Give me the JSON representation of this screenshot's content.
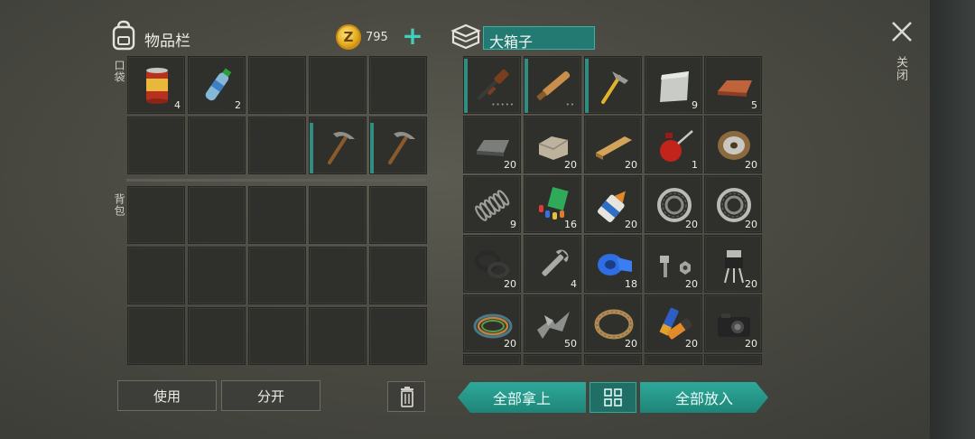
{
  "inventory": {
    "title": "物品栏",
    "coins": "795",
    "pocket_label": "口袋",
    "backpack_label": "背包",
    "pocket_slots": [
      {
        "icon": "canned-food-icon",
        "count": "4"
      },
      {
        "icon": "water-bottle-icon",
        "count": "2"
      },
      {
        "icon": "",
        "count": ""
      },
      {
        "icon": "",
        "count": ""
      },
      {
        "icon": "",
        "count": ""
      },
      {
        "icon": "",
        "count": ""
      },
      {
        "icon": "",
        "count": ""
      },
      {
        "icon": "",
        "count": ""
      },
      {
        "icon": "pickaxe-icon",
        "count": ""
      },
      {
        "icon": "pickaxe-icon",
        "count": ""
      }
    ],
    "backpack_slots": 15,
    "use_button": "使用",
    "split_button": "分开"
  },
  "chest": {
    "title": "大箱子",
    "take_all_button": "全部拿上",
    "put_all_button": "全部放入",
    "items": [
      {
        "icon": "shotgun-icon",
        "count": ""
      },
      {
        "icon": "wooden-club-icon",
        "count": ""
      },
      {
        "icon": "hammer-icon",
        "count": ""
      },
      {
        "icon": "metal-sheet-icon",
        "count": "9"
      },
      {
        "icon": "copper-ingot-icon",
        "count": "5"
      },
      {
        "icon": "iron-ingot-icon",
        "count": "20"
      },
      {
        "icon": "stone-block-icon",
        "count": "20"
      },
      {
        "icon": "wood-plank-icon",
        "count": "20"
      },
      {
        "icon": "oil-can-icon",
        "count": "1"
      },
      {
        "icon": "wire-spool-icon",
        "count": "20"
      },
      {
        "icon": "spring-icon",
        "count": "9"
      },
      {
        "icon": "pills-and-books-icon",
        "count": "16"
      },
      {
        "icon": "glue-tube-icon",
        "count": "20"
      },
      {
        "icon": "bearing-icon",
        "count": "20"
      },
      {
        "icon": "bearing-icon",
        "count": "20"
      },
      {
        "icon": "washers-icon",
        "count": "20"
      },
      {
        "icon": "wrench-icon",
        "count": "4"
      },
      {
        "icon": "tape-roll-icon",
        "count": "18"
      },
      {
        "icon": "bolt-and-nut-icon",
        "count": "20"
      },
      {
        "icon": "transistor-icon",
        "count": "20"
      },
      {
        "icon": "wire-coil-icon",
        "count": "20"
      },
      {
        "icon": "scrap-metal-icon",
        "count": "50"
      },
      {
        "icon": "rope-icon",
        "count": "20"
      },
      {
        "icon": "batteries-icon",
        "count": "20"
      },
      {
        "icon": "camera-icon",
        "count": "20"
      }
    ]
  },
  "close_label": "关闭",
  "colors": {
    "accent": "#2ea99a",
    "slot": "#2f302c",
    "background": "#4a4a42"
  }
}
